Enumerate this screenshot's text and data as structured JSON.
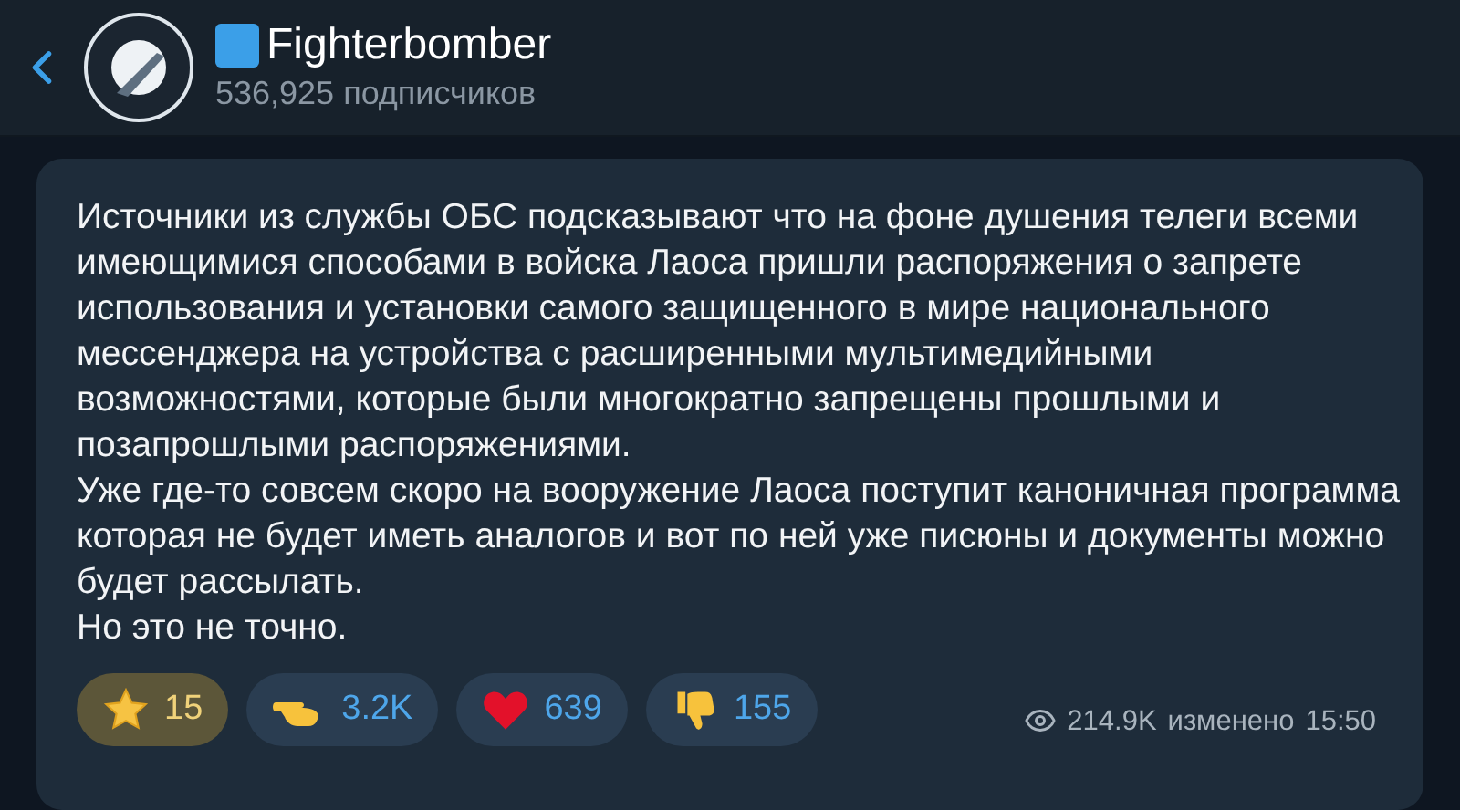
{
  "header": {
    "title": "Fighterbomber",
    "subtitle": "536,925 подписчиков"
  },
  "message": {
    "paragraphs": [
      "Источники из службы ОБС подсказывают что на фоне душения телеги всеми имеющимися способами в войска Лаоса пришли распоряжения о запрете использования и установки самого защищенного в мире национального мессенджера на устройства с расширенными мультимедийными возможностями, которые были многократно запрещены прошлыми и позапрошлыми распоряжениями.",
      "Уже где-то совсем скоро на вооружение Лаоса поступит каноничная программа которая не будет иметь аналогов и вот по ней уже писюны и документы можно будет рассылать.",
      "Но это не точно."
    ],
    "reactions": [
      {
        "kind": "star",
        "count": "15"
      },
      {
        "kind": "pointing",
        "count": "3.2K"
      },
      {
        "kind": "heart",
        "count": "639"
      },
      {
        "kind": "thumbs-down",
        "count": "155"
      }
    ],
    "views": "214.9K",
    "edited": "изменено",
    "time": "15:50"
  }
}
